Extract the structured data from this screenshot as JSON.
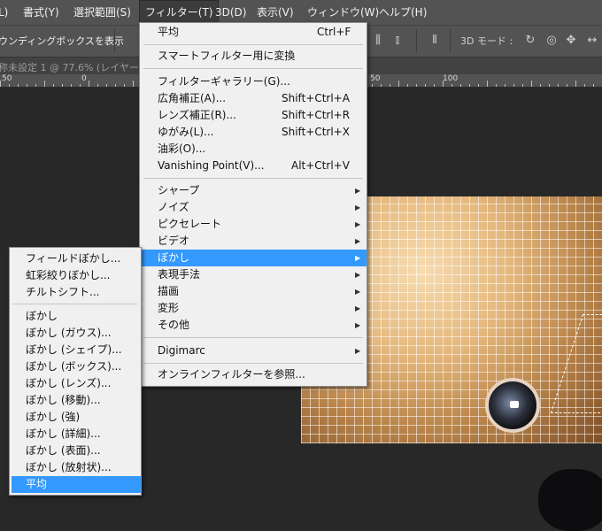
{
  "menubar": {
    "items": [
      "L)",
      "書式(Y)",
      "選択範囲(S)",
      "フィルター(T)",
      "3D(D)",
      "表示(V)",
      "ウィンドウ(W)",
      "ヘルプ(H)"
    ]
  },
  "options": {
    "bounding_label": "ウンディングボックスを表示",
    "mode_label": "3D モード :"
  },
  "tab": {
    "title": "称未設定 1 @ 77.6% (レイヤー"
  },
  "ruler": {
    "numbers": [
      "50",
      "0",
      "50",
      "100"
    ]
  },
  "filter_menu": {
    "items": [
      {
        "label": "平均",
        "shortcut": "Ctrl+F"
      },
      {
        "label": "スマートフィルター用に変換",
        "shortcut": ""
      },
      {
        "label": "フィルターギャラリー(G)...",
        "shortcut": ""
      },
      {
        "label": "広角補正(A)...",
        "shortcut": "Shift+Ctrl+A"
      },
      {
        "label": "レンズ補正(R)...",
        "shortcut": "Shift+Ctrl+R"
      },
      {
        "label": "ゆがみ(L)...",
        "shortcut": "Shift+Ctrl+X"
      },
      {
        "label": "油彩(O)...",
        "shortcut": ""
      },
      {
        "label": "Vanishing Point(V)...",
        "shortcut": "Alt+Ctrl+V"
      },
      {
        "label": "シャープ",
        "submenu": true
      },
      {
        "label": "ノイズ",
        "submenu": true
      },
      {
        "label": "ピクセレート",
        "submenu": true
      },
      {
        "label": "ビデオ",
        "submenu": true
      },
      {
        "label": "ぼかし",
        "submenu": true,
        "highlighted": true
      },
      {
        "label": "表現手法",
        "submenu": true
      },
      {
        "label": "描画",
        "submenu": true
      },
      {
        "label": "変形",
        "submenu": true
      },
      {
        "label": "その他",
        "submenu": true
      },
      {
        "label": "Digimarc",
        "submenu": true
      },
      {
        "label": "オンラインフィルターを参照...",
        "shortcut": ""
      }
    ]
  },
  "blur_submenu": {
    "items": [
      {
        "label": "フィールドぼかし..."
      },
      {
        "label": "虹彩絞りぼかし..."
      },
      {
        "label": "チルトシフト..."
      },
      {
        "label": "ぼかし"
      },
      {
        "label": "ぼかし (ガウス)..."
      },
      {
        "label": "ぼかし (シェイプ)..."
      },
      {
        "label": "ぼかし (ボックス)..."
      },
      {
        "label": "ぼかし (レンズ)..."
      },
      {
        "label": "ぼかし (移動)..."
      },
      {
        "label": "ぼかし (強)"
      },
      {
        "label": "ぼかし (詳細)..."
      },
      {
        "label": "ぼかし (表面)..."
      },
      {
        "label": "ぼかし (放射状)..."
      },
      {
        "label": "平均",
        "highlighted": true
      }
    ]
  },
  "colors": {
    "highlight": "#3399ff",
    "menu_bg": "#f0f0f0",
    "chrome": "#535353",
    "canvas": "#282828"
  }
}
